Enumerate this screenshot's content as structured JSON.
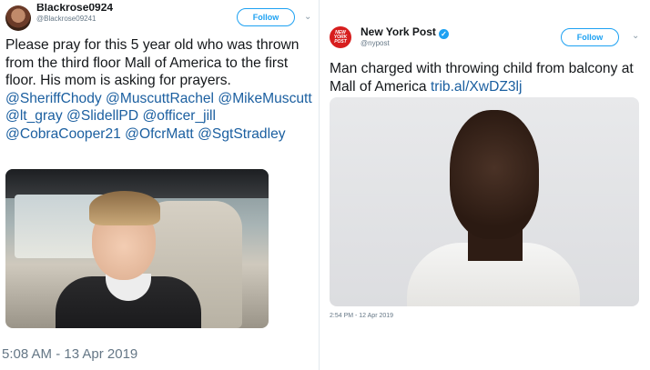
{
  "left_tweet": {
    "display_name": "Blackrose0924",
    "handle": "@Blackrose09241",
    "follow_label": "Follow",
    "text_plain": "Please pray for this 5 year old who was thrown from the third floor Mall of America to the first floor. His mom is asking for prayers.",
    "mentions": [
      "@SheriffChody",
      "@MuscuttRachel",
      "@MikeMuscutt",
      "@lt_gray",
      "@SlidellPD",
      "@officer_jill",
      "@CobraCooper21",
      "@OfcrMatt",
      "@SgtStradley"
    ],
    "timestamp": "5:08 AM - 13 Apr 2019"
  },
  "right_tweet": {
    "display_name": "New York Post",
    "logo_text": "NEW YORK POST",
    "handle": "@nypost",
    "follow_label": "Follow",
    "text_plain": "Man charged with throwing child from balcony at Mall of America",
    "link_text": "trib.al/XwDZ3lj",
    "timestamp": "2:54 PM - 12 Apr 2019"
  },
  "colors": {
    "accent": "#1da1f2",
    "link": "#1b5fa0",
    "secondary_text": "#657786",
    "nyp_red": "#d71e1e"
  },
  "icons": [
    "chevron-down-icon",
    "verified-badge-icon"
  ]
}
